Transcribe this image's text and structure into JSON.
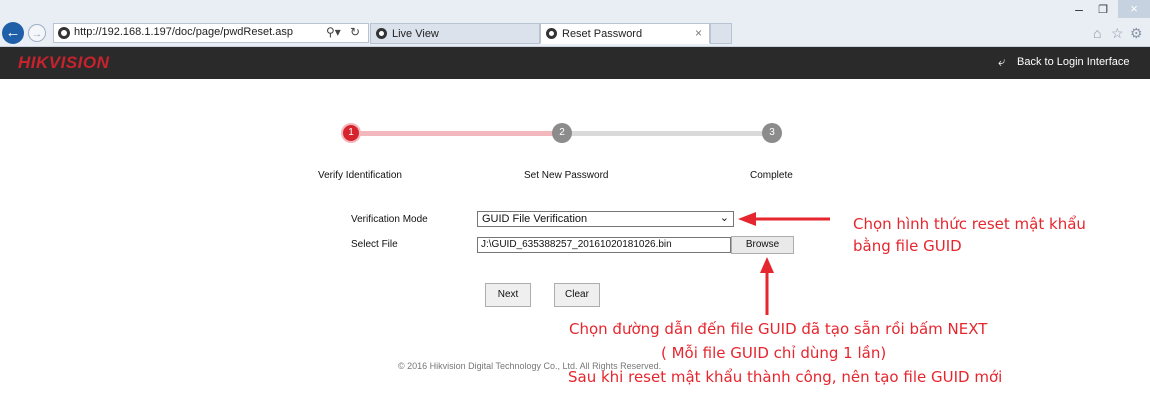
{
  "browser": {
    "url_host": "http://192.168.1.197",
    "url_path": "/doc/page/pwdReset.asp",
    "tabs": [
      {
        "label": "Live View",
        "active": false
      },
      {
        "label": "Reset Password",
        "active": true
      }
    ]
  },
  "header": {
    "logo": "HIKVISION",
    "back_label": "Back to Login Interface",
    "brand_color": "#c8222d"
  },
  "steps": [
    {
      "number": "1",
      "label": "Verify Identification",
      "state": "active"
    },
    {
      "number": "2",
      "label": "Set New Password",
      "state": "pending"
    },
    {
      "number": "3",
      "label": "Complete",
      "state": "pending"
    }
  ],
  "form": {
    "mode_label": "Verification Mode",
    "mode_value": "GUID File Verification",
    "file_label": "Select File",
    "file_value": "J:\\GUID_635388257_20161020181026.bin",
    "browse_label": "Browse",
    "next_label": "Next",
    "clear_label": "Clear"
  },
  "footer": {
    "copyright": "© 2016 Hikvision Digital Technology Co., Ltd. All Rights Reserved."
  },
  "annotations": {
    "color": "#e6262e",
    "mode_note_line1": "Chọn hình thức reset mật khẩu",
    "mode_note_line2": "bằng file GUID",
    "file_note_line1": "Chọn đường dẫn đến file GUID đã tạo sẵn rồi bấm NEXT",
    "file_note_line2": "( Mỗi file GUID chỉ dùng 1 lần)",
    "file_note_line3": "Sau khi reset mật khẩu thành công, nên tạo file GUID mới"
  }
}
